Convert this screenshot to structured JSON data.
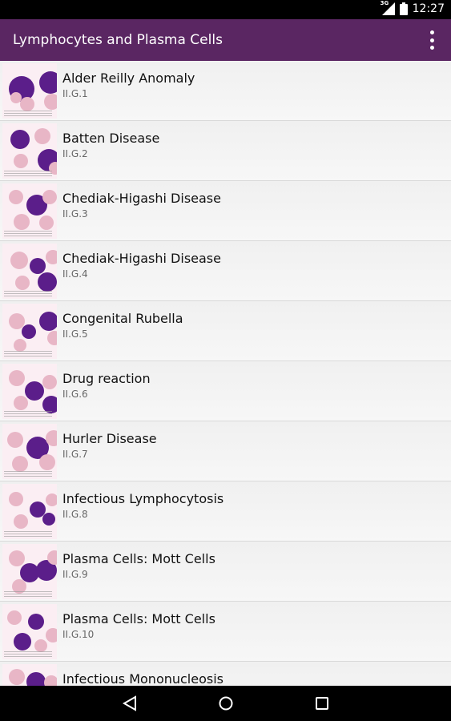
{
  "status": {
    "network": "3G",
    "time": "12:27"
  },
  "app_bar": {
    "title": "Lymphocytes and Plasma Cells",
    "menu_icon": "more-vert-icon"
  },
  "items": [
    {
      "title": "Alder Reilly Anomaly",
      "code": "II.G.1"
    },
    {
      "title": "Batten Disease",
      "code": "II.G.2"
    },
    {
      "title": "Chediak-Higashi Disease",
      "code": "II.G.3"
    },
    {
      "title": "Chediak-Higashi Disease",
      "code": "II.G.4"
    },
    {
      "title": "Congenital Rubella",
      "code": "II.G.5"
    },
    {
      "title": "Drug reaction",
      "code": "II.G.6"
    },
    {
      "title": "Hurler Disease",
      "code": "II.G.7"
    },
    {
      "title": "Infectious Lymphocytosis",
      "code": "II.G.8"
    },
    {
      "title": "Plasma Cells: Mott Cells",
      "code": "II.G.9"
    },
    {
      "title": "Plasma Cells: Mott Cells",
      "code": "II.G.10"
    },
    {
      "title": "Infectious Mononucleosis",
      "code": ""
    }
  ],
  "nav": {
    "back": "back-icon",
    "home": "home-icon",
    "recents": "recents-icon"
  },
  "colors": {
    "app_bar": "#5a2662",
    "cell_dark": "#5b1e8a",
    "rbc": "#e8b6c6"
  }
}
